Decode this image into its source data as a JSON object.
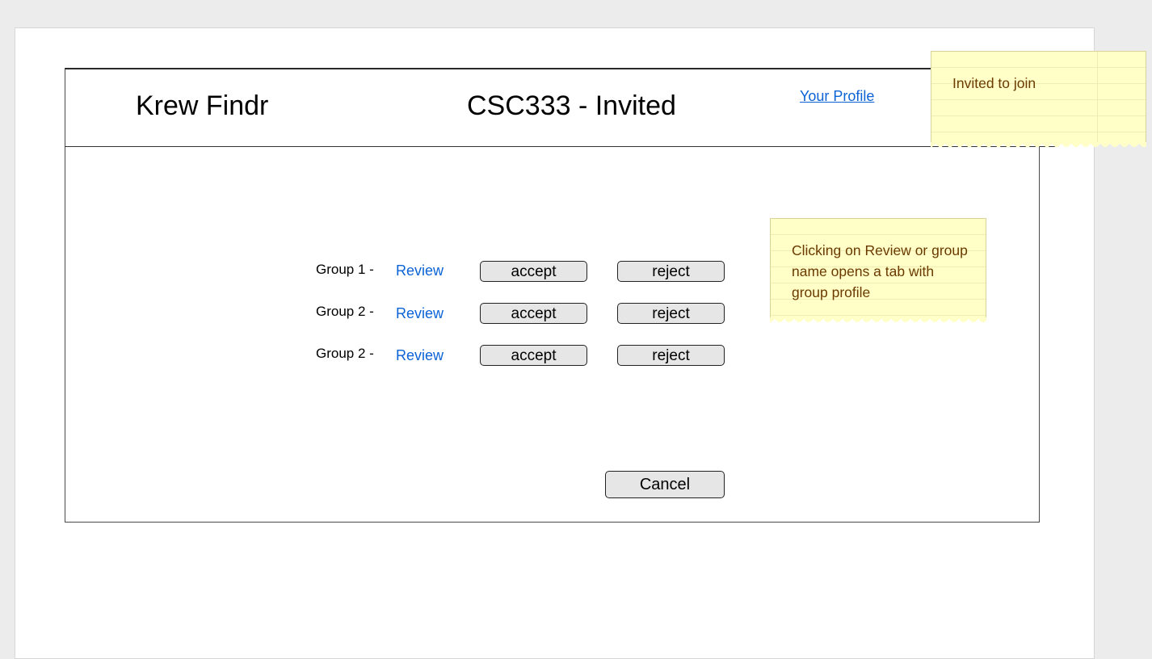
{
  "header": {
    "app_title": "Krew Findr",
    "page_title": "CSC333 - Invited",
    "profile_link": "Your Profile"
  },
  "invitations": [
    {
      "group": "Group 1 -",
      "review": "Review",
      "accept": "accept",
      "reject": "reject"
    },
    {
      "group": "Group 2 -",
      "review": "Review",
      "accept": "accept",
      "reject": "reject"
    },
    {
      "group": "Group 2 -",
      "review": "Review",
      "accept": "accept",
      "reject": "reject"
    }
  ],
  "footer": {
    "cancel_label": "Cancel"
  },
  "notes": {
    "header_note": "Invited to join",
    "review_note": "Clicking on Review or group name opens a tab with group profile"
  },
  "colors": {
    "link": "#0b63d6",
    "note_background": "#ffffc7",
    "note_text": "#6a3a00",
    "button_background": "#e6e6e6"
  }
}
